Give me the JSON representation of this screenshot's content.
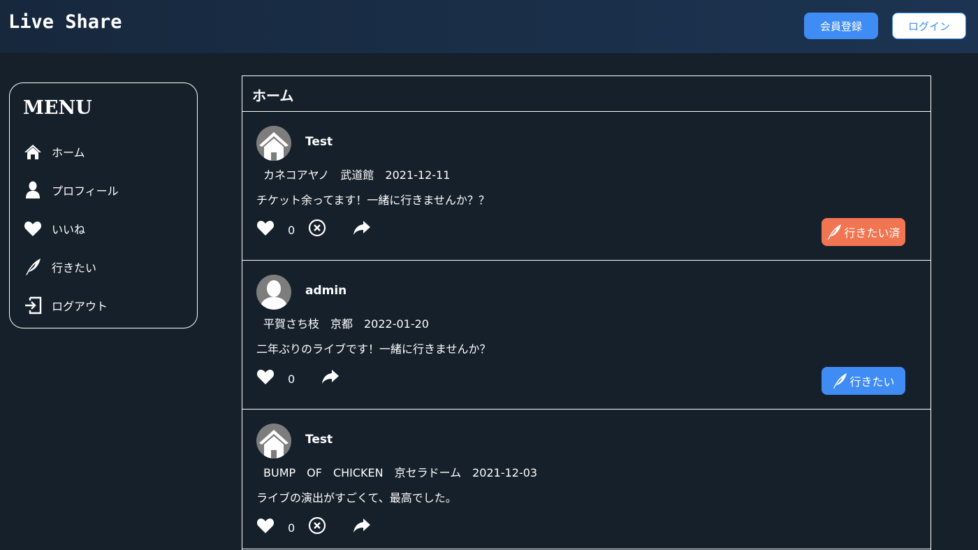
{
  "app": {
    "logo": "Live Share",
    "register_label": "会員登録",
    "login_label": "ログイン"
  },
  "menu": {
    "title": "MENU",
    "items": [
      {
        "label": "ホーム",
        "icon": "home-icon"
      },
      {
        "label": "プロフィール",
        "icon": "user-icon"
      },
      {
        "label": "いいね",
        "icon": "heart-icon"
      },
      {
        "label": "行きたい",
        "icon": "feather-icon"
      },
      {
        "label": "ログアウト",
        "icon": "logout-icon"
      }
    ]
  },
  "feed": {
    "title": "ホーム",
    "posts": [
      {
        "user": "Test",
        "avatar": "house-avatar",
        "meta": "カネコアヤノ　武道館　2021-12-11",
        "body": "チケット余ってます！一緒に行きませんか？？",
        "likes": "0",
        "want_label": "行きたい済",
        "want_color": "#f27552"
      },
      {
        "user": "admin",
        "avatar": "person-avatar",
        "meta": "平賀さち枝　京都　2022-01-20",
        "body": "二年ぶりのライブです！一緒に行きませんか？",
        "likes": "0",
        "want_label": "行きたい",
        "want_color": "#3f8cf5"
      },
      {
        "user": "Test",
        "avatar": "house-avatar",
        "meta": "BUMP　OF　CHICKEN　京セラドーム　2021-12-03",
        "body": "ライブの演出がすごくて、最高でした。",
        "likes": "0"
      }
    ]
  },
  "colors": {
    "background": "#16202b",
    "header": "#1c3452",
    "accent_blue": "#3f8cf5",
    "accent_orange": "#f27552"
  }
}
